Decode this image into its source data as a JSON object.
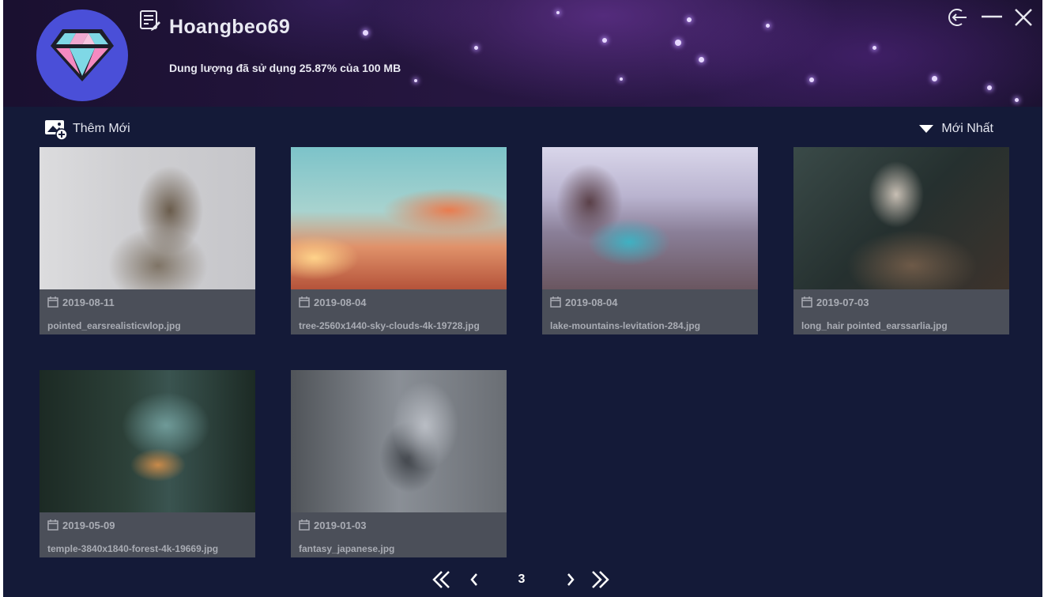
{
  "profile": {
    "username": "Hoangbeo69",
    "storage_text": "Dung lượng đã sử dụng 25.87% của 100 MB",
    "storage_used_percent": 25.87,
    "storage_total": "100 MB",
    "avatar_icon": "diamond-icon"
  },
  "window_controls": {
    "logout_icon": "logout-icon",
    "minimize_icon": "minimize-icon",
    "close_icon": "close-icon"
  },
  "toolbar": {
    "add_new_label": "Thêm Mới",
    "add_new_icon": "add-image-icon",
    "sort_label": "Mới Nhất",
    "sort_icon": "caret-down-icon"
  },
  "gallery": {
    "items": [
      {
        "date": "2019-08-11",
        "filename": "pointed_earsrealisticwlop.jpg",
        "palette": [
          "#d8d8da",
          "#8a7d6e",
          "#5d5650"
        ]
      },
      {
        "date": "2019-08-04",
        "filename": "tree-2560x1440-sky-clouds-4k-19728.jpg",
        "palette": [
          "#7cc3c9",
          "#e57a48",
          "#c25a3c"
        ]
      },
      {
        "date": "2019-08-04",
        "filename": "lake-mountains-levitation-284.jpg",
        "palette": [
          "#c9c7e0",
          "#4aa9b8",
          "#5f4a52"
        ]
      },
      {
        "date": "2019-07-03",
        "filename": "long_hair pointed_earssarlia.jpg",
        "palette": [
          "#2a3a3a",
          "#8a8a7c",
          "#3a2c26"
        ]
      },
      {
        "date": "2019-05-09",
        "filename": "temple-3840x1840-forest-4k-19669.jpg",
        "palette": [
          "#1f2f28",
          "#5a8a88",
          "#2c3a2c"
        ]
      },
      {
        "date": "2019-01-03",
        "filename": "fantasy_japanese.jpg",
        "palette": [
          "#9aa0a8",
          "#55595f",
          "#2d3036"
        ]
      }
    ]
  },
  "pagination": {
    "current_page": "3",
    "first_icon": "double-chevron-left-icon",
    "prev_icon": "chevron-left-icon",
    "next_icon": "chevron-right-icon",
    "last_icon": "double-chevron-right-icon"
  },
  "colors": {
    "background": "#141a38",
    "card": "#4b4f59",
    "card_text": "#a9acb4",
    "avatar": "#4a4fd8"
  }
}
